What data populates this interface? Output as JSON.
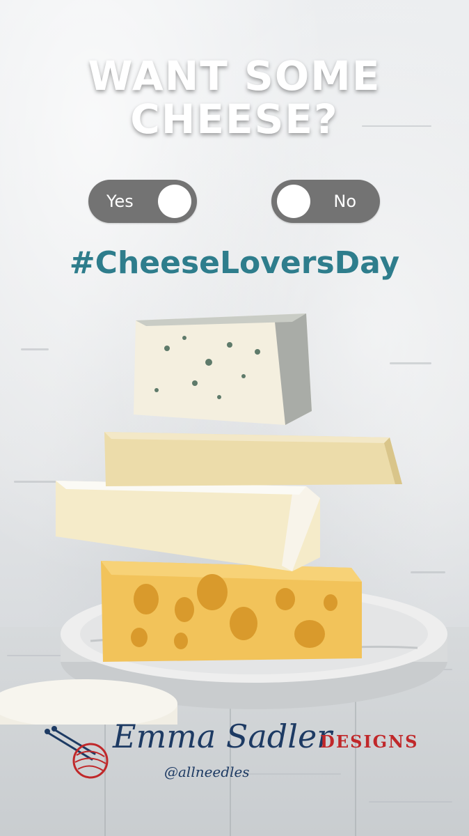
{
  "headline": {
    "line1": "WANT SOME",
    "line2": "CHEESE?"
  },
  "toggles": {
    "yes_label": "Yes",
    "no_label": "No"
  },
  "hashtag": "#CheeseLoversDay",
  "brand": {
    "name_script": "Emma Sadler",
    "name_designs": "DESIGNS",
    "handle": "@allneedles"
  },
  "colors": {
    "hashtag": "#2e7d8c",
    "toggle": "#737373",
    "brand_navy": "#1d3a63",
    "brand_red": "#c0282a"
  },
  "icons": [
    "yarn-ball-icon",
    "knitting-needles-icon"
  ]
}
